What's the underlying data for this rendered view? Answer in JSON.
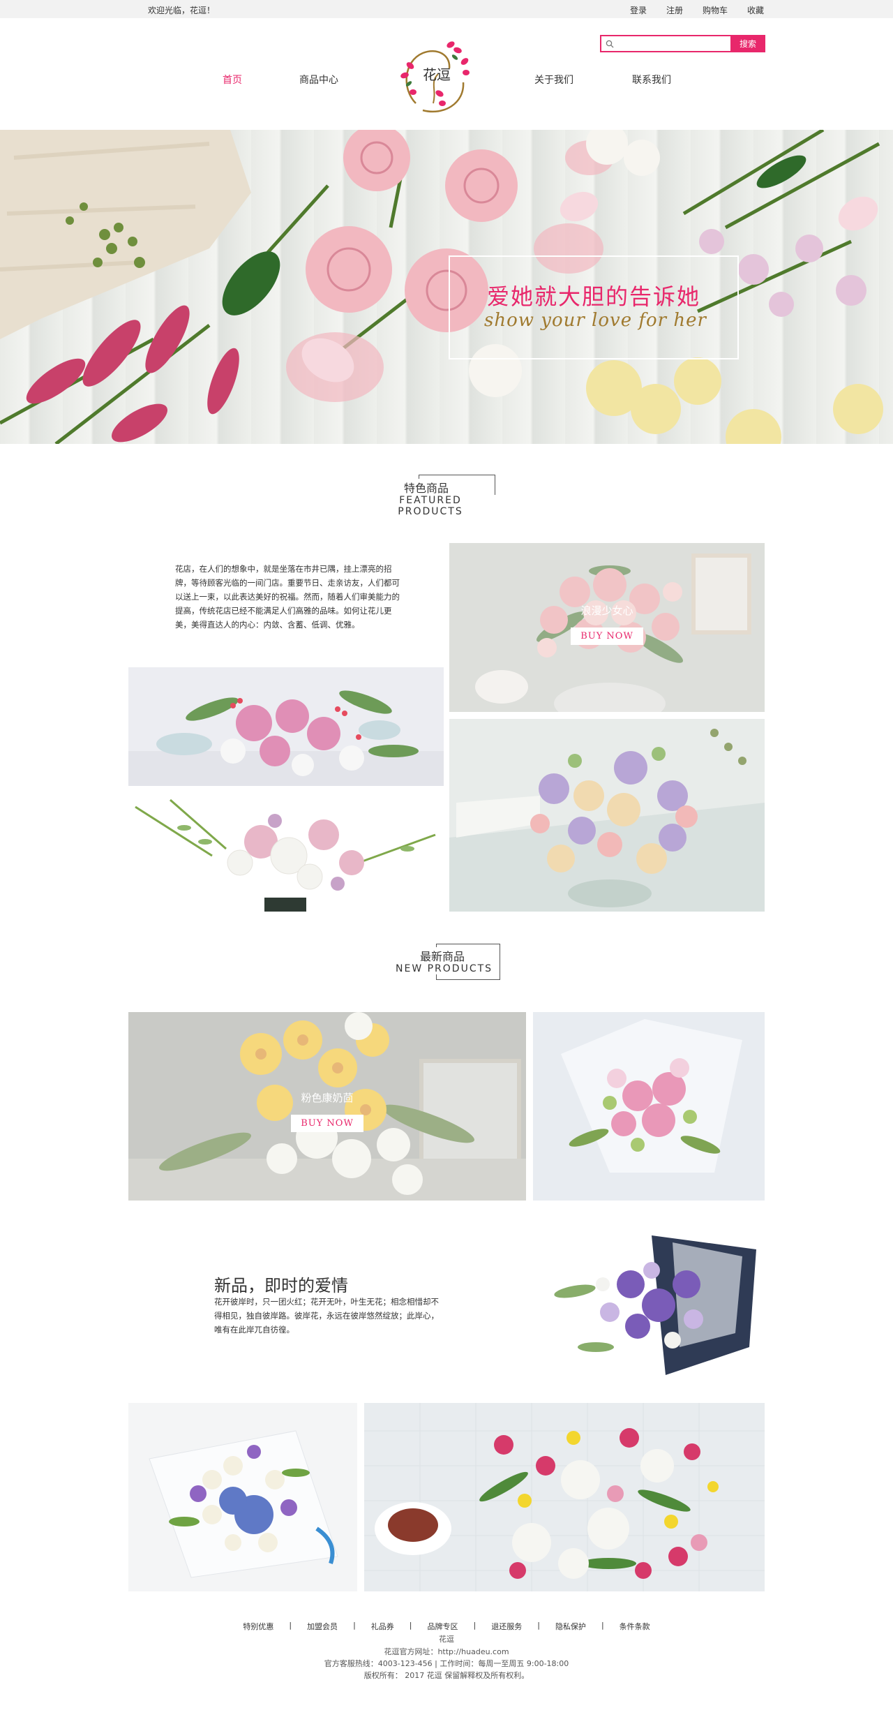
{
  "topbar": {
    "welcome": "欢迎光临，花逗！",
    "links": [
      "登录",
      "注册",
      "购物车",
      "收藏"
    ]
  },
  "search": {
    "placeholder": "",
    "button": "搜索"
  },
  "nav": {
    "home": "首页",
    "products": "商品中心",
    "about": "关于我们",
    "contact": "联系我们"
  },
  "logo": {
    "text": "花逗"
  },
  "banner": {
    "headline": "爱她就大胆的告诉她",
    "subline": "show your love for her"
  },
  "featured": {
    "title_cn": "特色商品",
    "title_en": "FEATURED PRODUCTS",
    "description": "花店，在人们的想象中，就是坐落在市井已隅，挂上漂亮的招牌，等待顾客光临的一间门店。重要节日、走亲访友，人们都可以送上一束，以此表达美好的祝福。然而，随着人们审美能力的提高，传统花店已经不能满足人们高雅的品味。如何让花儿更美，美得直达人的内心：内敛、含蓄、低调、优雅。",
    "product_name": "浪漫少女心",
    "buy_label": "BUY NOW"
  },
  "new_products": {
    "title_cn": "最新商品",
    "title_en": "NEW PRODUCTS",
    "product_name": "粉色康奶茴",
    "buy_label": "BUY NOW",
    "heading": "新品，即时的爱情",
    "description": "花开彼岸时，只一团火红；花开无叶，叶生无花；相念相惜却不得相见，独自彼岸路。彼岸花，永远在彼岸悠然绽放；此岸心，唯有在此岸兀自彷徨。"
  },
  "footer": {
    "links": [
      "特别优惠",
      "加盟会员",
      "礼品券",
      "品牌专区",
      "退还服务",
      "隐私保护",
      "条件条款"
    ],
    "brand": "花逗",
    "website": "花逗官方网址：http://huadeu.com",
    "service": "官方客服热线：4003-123-456 | 工作时间：每周一至周五 9:00-18:00",
    "copyright": "版权所有： 2017 花逗 保留解释权及所有权利。"
  },
  "colors": {
    "accent": "#e8276b",
    "logo_gold": "#a07a2f"
  },
  "icons": {
    "search": "search-icon",
    "logo": "flower-logo-icon"
  }
}
